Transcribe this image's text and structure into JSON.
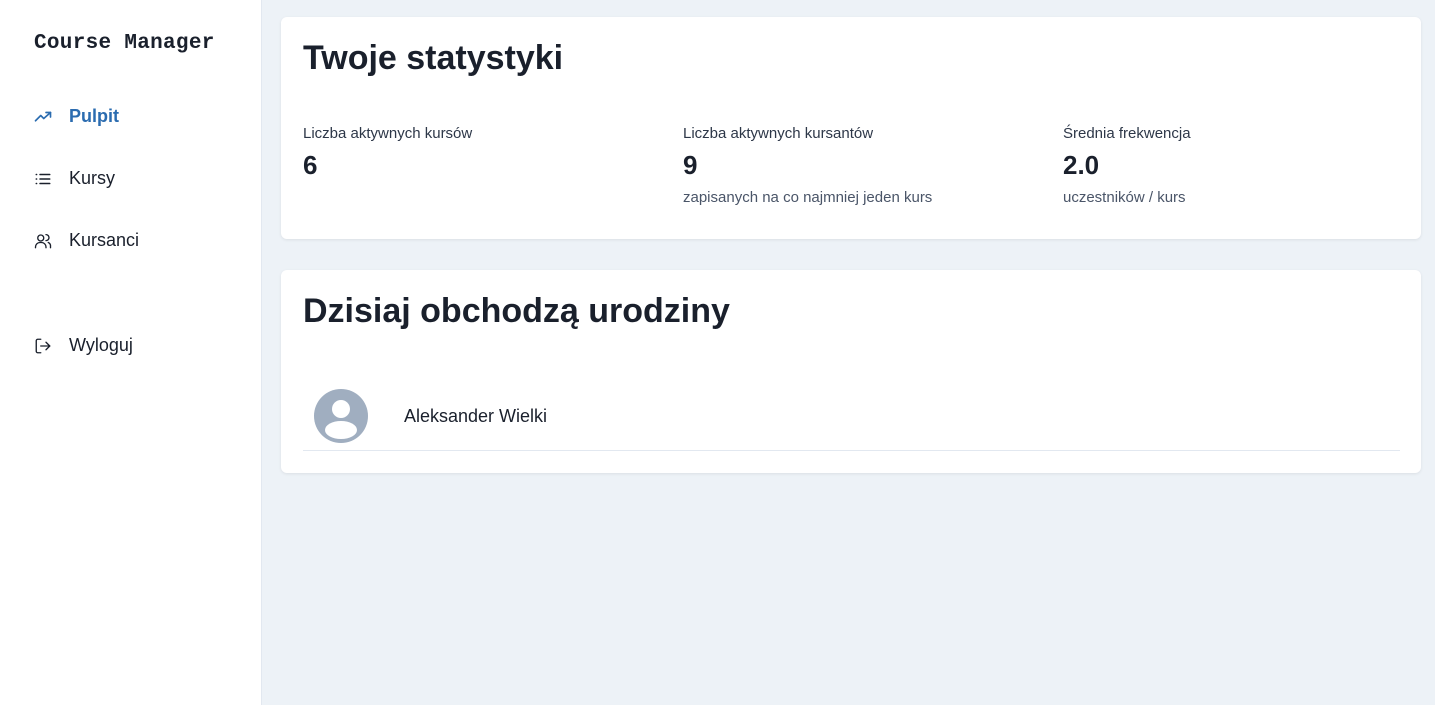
{
  "app": {
    "title": "Course Manager"
  },
  "sidebar": {
    "items": [
      {
        "label": "Pulpit",
        "icon": "trending-up-icon",
        "active": true
      },
      {
        "label": "Kursy",
        "icon": "list-icon",
        "active": false
      },
      {
        "label": "Kursanci",
        "icon": "users-icon",
        "active": false
      },
      {
        "label": "Wyloguj",
        "icon": "logout-icon",
        "active": false
      }
    ]
  },
  "stats": {
    "title": "Twoje statystyki",
    "items": [
      {
        "label": "Liczba aktywnych kursów",
        "value": "6",
        "sub": ""
      },
      {
        "label": "Liczba aktywnych kursantów",
        "value": "9",
        "sub": "zapisanych na co najmniej jeden kurs"
      },
      {
        "label": "Średnia frekwencja",
        "value": "2.0",
        "sub": "uczestników / kurs"
      }
    ]
  },
  "birthdays": {
    "title": "Dzisiaj obchodzą urodziny",
    "people": [
      {
        "name": "Aleksander Wielki"
      }
    ]
  },
  "colors": {
    "accent": "#2b6cb0",
    "background": "#edf2f7",
    "text": "#1a202c",
    "avatar": "#a0aec0"
  }
}
